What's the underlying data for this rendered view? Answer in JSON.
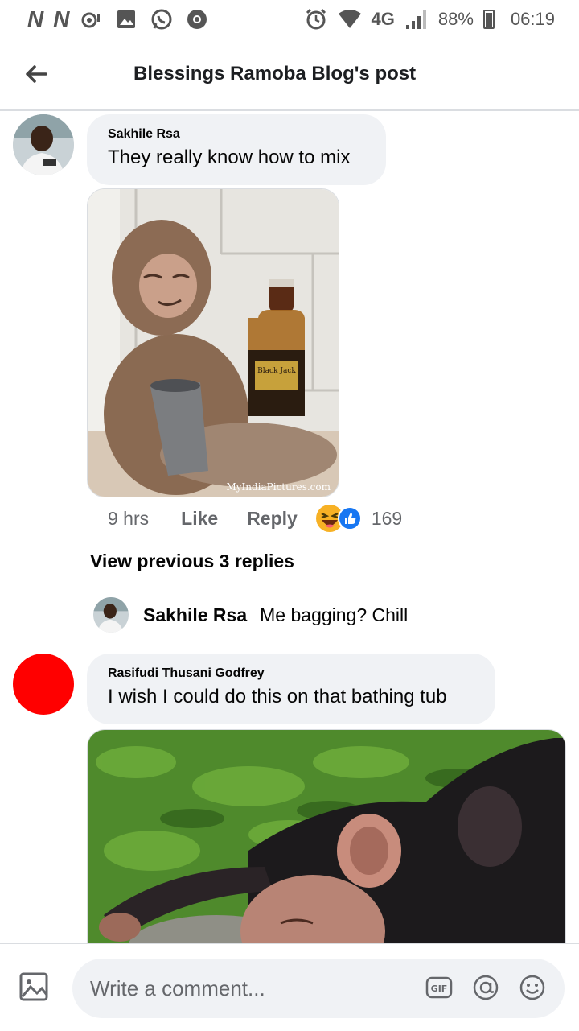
{
  "status_bar": {
    "left_glyphs": [
      "N",
      "N"
    ],
    "network": "4G",
    "battery": "88%",
    "time": "06:19"
  },
  "header": {
    "title": "Blessings Ramoba Blog's post"
  },
  "comments": [
    {
      "author": "Sakhile Rsa",
      "text": "They really know how to mix",
      "photo_watermark": "MyIndiaPictures.com",
      "bottle_label": "Black Jack",
      "time": "9 hrs",
      "like_label": "Like",
      "reply_label": "Reply",
      "reaction_count": "169"
    },
    {
      "author": "Rasifudi Thusani Godfrey",
      "text": "I wish I could do this on that bathing tub"
    }
  ],
  "view_previous": "View previous 3 replies",
  "reply": {
    "author": "Sakhile Rsa",
    "text": "Me bagging? Chill"
  },
  "composer": {
    "placeholder": "Write a comment..."
  },
  "colors": {
    "bubble": "#f0f2f5",
    "secondary_text": "#65676b",
    "divider": "#dadde1",
    "avatar_red": "#ff0000",
    "like_blue": "#1877f2",
    "haha_yellow": "#f7b125"
  }
}
